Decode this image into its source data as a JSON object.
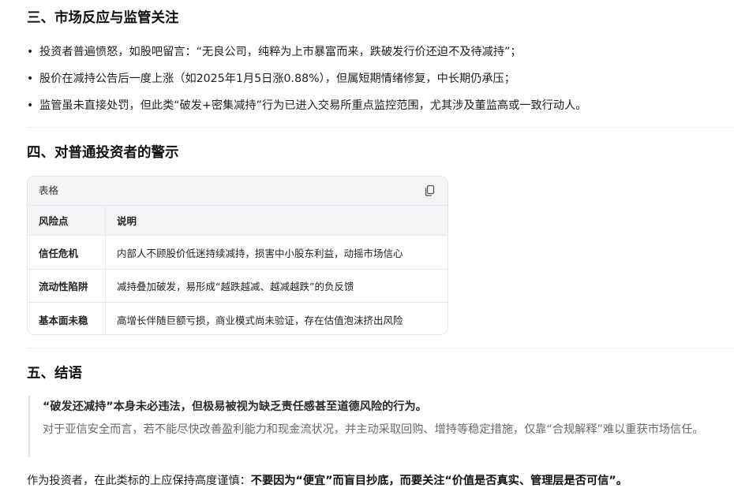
{
  "section3": {
    "title": "三、市场反应与监管关注",
    "bullets": [
      "投资者普遍愤怒，如股吧留言：“无良公司，纯粹为上市暴富而来，跌破发行价还迫不及待减持”；",
      "股价在减持公告后一度上涨（如2025年1月5日涨0.88%），但属短期情绪修复，中长期仍承压；",
      "监管虽未直接处罚，但此类“破发+密集减持”行为已进入交易所重点监控范围，尤其涉及董监高或一致行动人。"
    ]
  },
  "section4": {
    "title": "四、对普通投资者的警示",
    "table": {
      "label": "表格",
      "copy_icon": "copy-icon",
      "headers": [
        "风险点",
        "说明"
      ],
      "rows": [
        [
          "信任危机",
          "内部人不顾股价低迷持续减持，损害中小股东利益，动摇市场信心"
        ],
        [
          "流动性陷阱",
          "减持叠加破发，易形成“越跌越减、越减越跌”的负反馈"
        ],
        [
          "基本面未稳",
          "高增长伴随巨额亏损，商业模式尚未验证，存在估值泡沫挤出风险"
        ]
      ]
    }
  },
  "section5": {
    "title": "五、结语",
    "quote_strong": "“破发还减持”本身未必违法，但极易被视为缺乏责任感甚至道德风险的行为。",
    "quote_body": "对于亚信安全而言，若不能尽快改善盈利能力和现金流状况，并主动采取回购、增持等稳定措施，仅靠“合规解释”难以重获市场信任。",
    "conclusion_prefix": "作为投资者，在此类标的上应保持高度谨慎：",
    "conclusion_bold": "不要因为“便宜”而盲目抄底，而要关注“价值是否真实、管理层是否可信”。"
  },
  "colors": {
    "text": "#1f1f1f",
    "muted": "#6a6a6a",
    "table_header_bg": "#f3f4f6",
    "border": "#e4e6ea"
  }
}
